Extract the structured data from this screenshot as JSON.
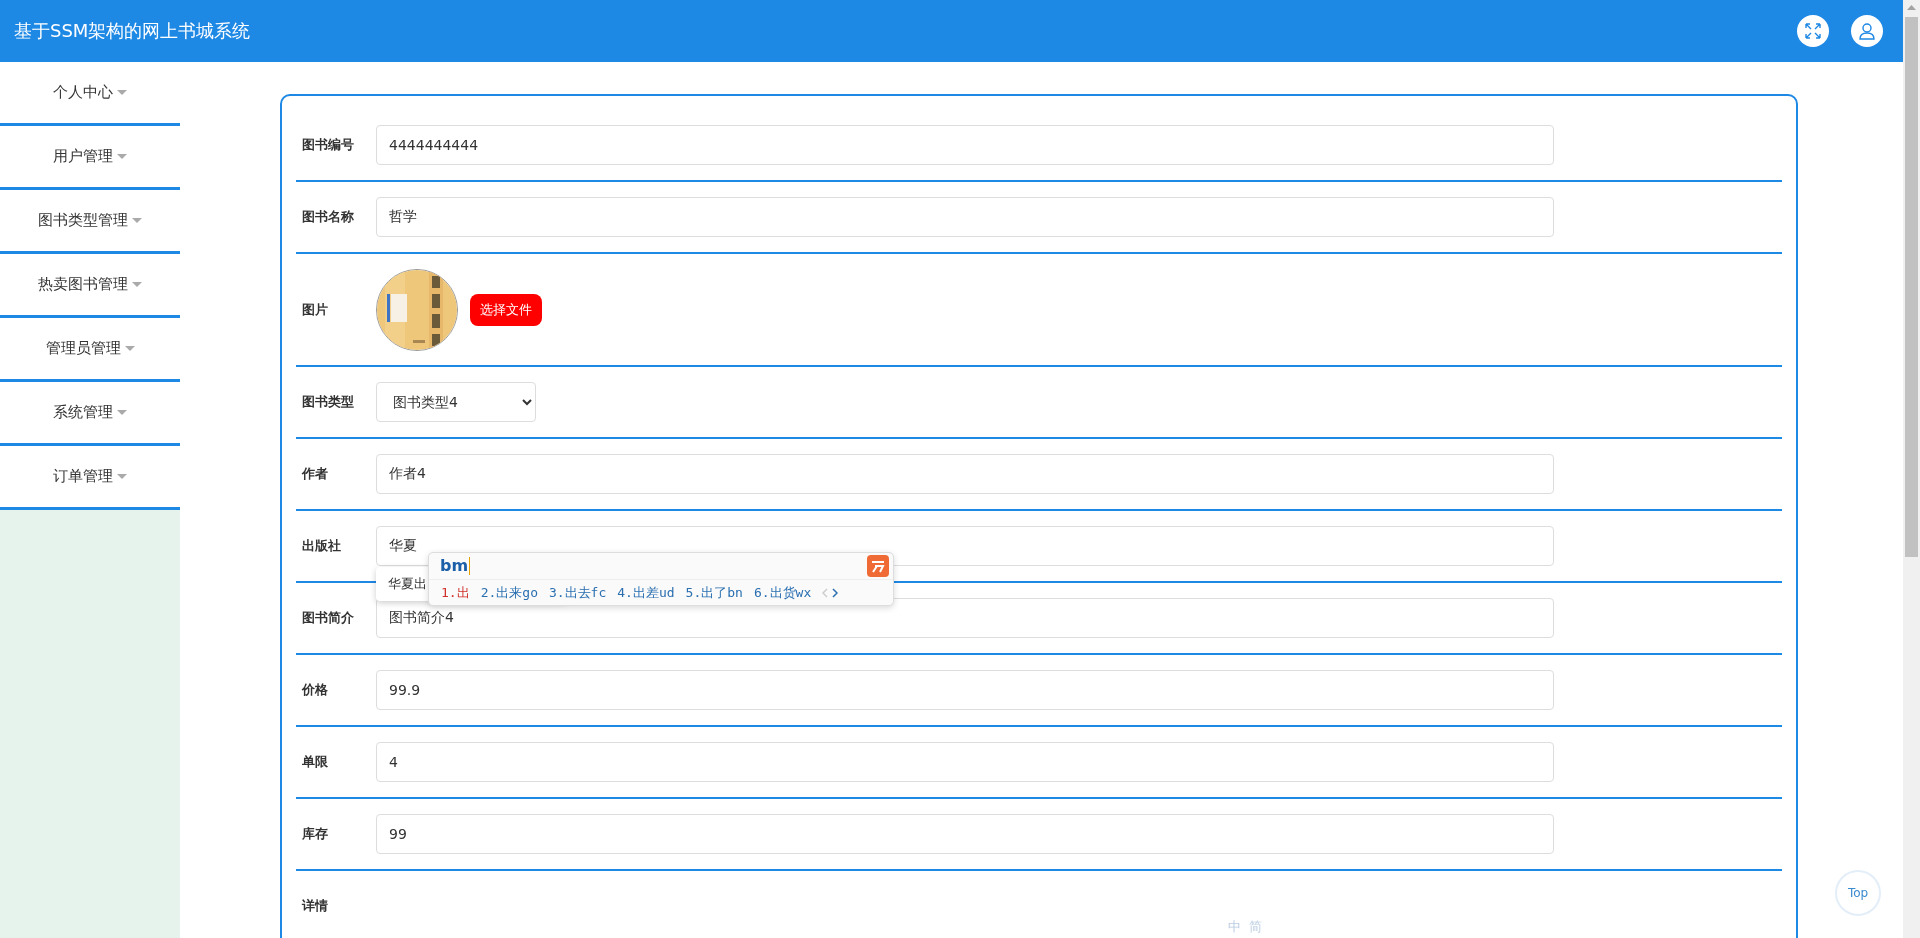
{
  "header": {
    "title": "基于SSM架构的网上书城系统"
  },
  "sidebar": {
    "items": [
      {
        "label": "个人中心"
      },
      {
        "label": "用户管理"
      },
      {
        "label": "图书类型管理"
      },
      {
        "label": "热卖图书管理"
      },
      {
        "label": "管理员管理"
      },
      {
        "label": "系统管理"
      },
      {
        "label": "订单管理"
      }
    ]
  },
  "form": {
    "fields": [
      {
        "kind": "text",
        "label": "图书编号",
        "value": "4444444444"
      },
      {
        "kind": "text",
        "label": "图书名称",
        "value": "哲学"
      },
      {
        "label": "图片",
        "button": "选择文件"
      },
      {
        "kind": "select",
        "label": "图书类型",
        "value": "图书类型4"
      },
      {
        "kind": "text",
        "label": "作者",
        "value": "作者4"
      },
      {
        "kind": "text",
        "label": "出版社",
        "value": "华夏",
        "suggestions": [
          "华夏出"
        ]
      },
      {
        "kind": "text",
        "label": "图书简介",
        "value": "图书简介4"
      },
      {
        "kind": "text",
        "label": "价格",
        "value": "99.9"
      },
      {
        "kind": "text",
        "label": "单限",
        "value": "4"
      },
      {
        "kind": "text",
        "label": "库存",
        "value": "99"
      },
      {
        "kind": "detail",
        "label": "详情"
      }
    ]
  },
  "ime": {
    "composition": "bm",
    "candidates": [
      {
        "label": "1.出",
        "selected": true
      },
      {
        "label": "2.出来go",
        "selected": false
      },
      {
        "label": "3.出去fc",
        "selected": false
      },
      {
        "label": "4.出差ud",
        "selected": false
      },
      {
        "label": "5.出了bn",
        "selected": false
      },
      {
        "label": "6.出货wx",
        "selected": false
      }
    ],
    "toolbar": [
      "中",
      "简"
    ]
  },
  "top_button": "Top"
}
